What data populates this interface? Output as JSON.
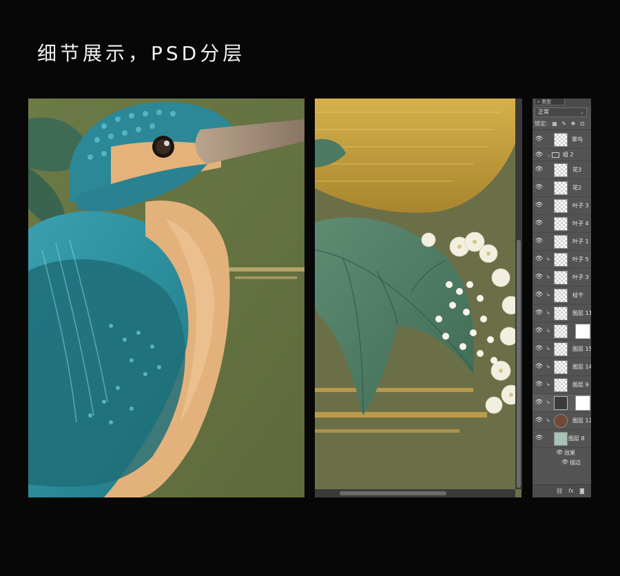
{
  "title": "细节展示，PSD分层",
  "colors": {
    "background": "#070707",
    "canvas_green": "#6a6f47",
    "panel_gray": "#535353"
  },
  "layers_panel": {
    "search_label": "类型",
    "blend_mode": "正常",
    "lock_label": "锁定:",
    "layers": [
      {
        "name": "翠鸟",
        "type": "layer"
      },
      {
        "name": "组 2",
        "type": "group"
      },
      {
        "name": "花3",
        "type": "layer"
      },
      {
        "name": "花2",
        "type": "layer"
      },
      {
        "name": "叶子 3",
        "type": "layer"
      },
      {
        "name": "叶子 4",
        "type": "layer"
      },
      {
        "name": "叶子 1",
        "type": "layer"
      },
      {
        "name": "叶子 5",
        "type": "layer"
      },
      {
        "name": "叶子 3",
        "type": "layer"
      },
      {
        "name": "枝干",
        "type": "layer"
      },
      {
        "name": "图层 11",
        "type": "layer"
      },
      {
        "name": "",
        "type": "masked"
      },
      {
        "name": "图层 15",
        "type": "layer"
      },
      {
        "name": "图层 14",
        "type": "layer"
      },
      {
        "name": "图层 9",
        "type": "layer"
      },
      {
        "name": "",
        "type": "adjustment"
      },
      {
        "name": "图层 12",
        "type": "layer"
      },
      {
        "name": "图层 8",
        "type": "layer"
      }
    ],
    "effects_label": "效果",
    "stroke_label": "描边",
    "bottom_icons": [
      "link-icon",
      "fx-icon",
      "mask-icon"
    ]
  }
}
